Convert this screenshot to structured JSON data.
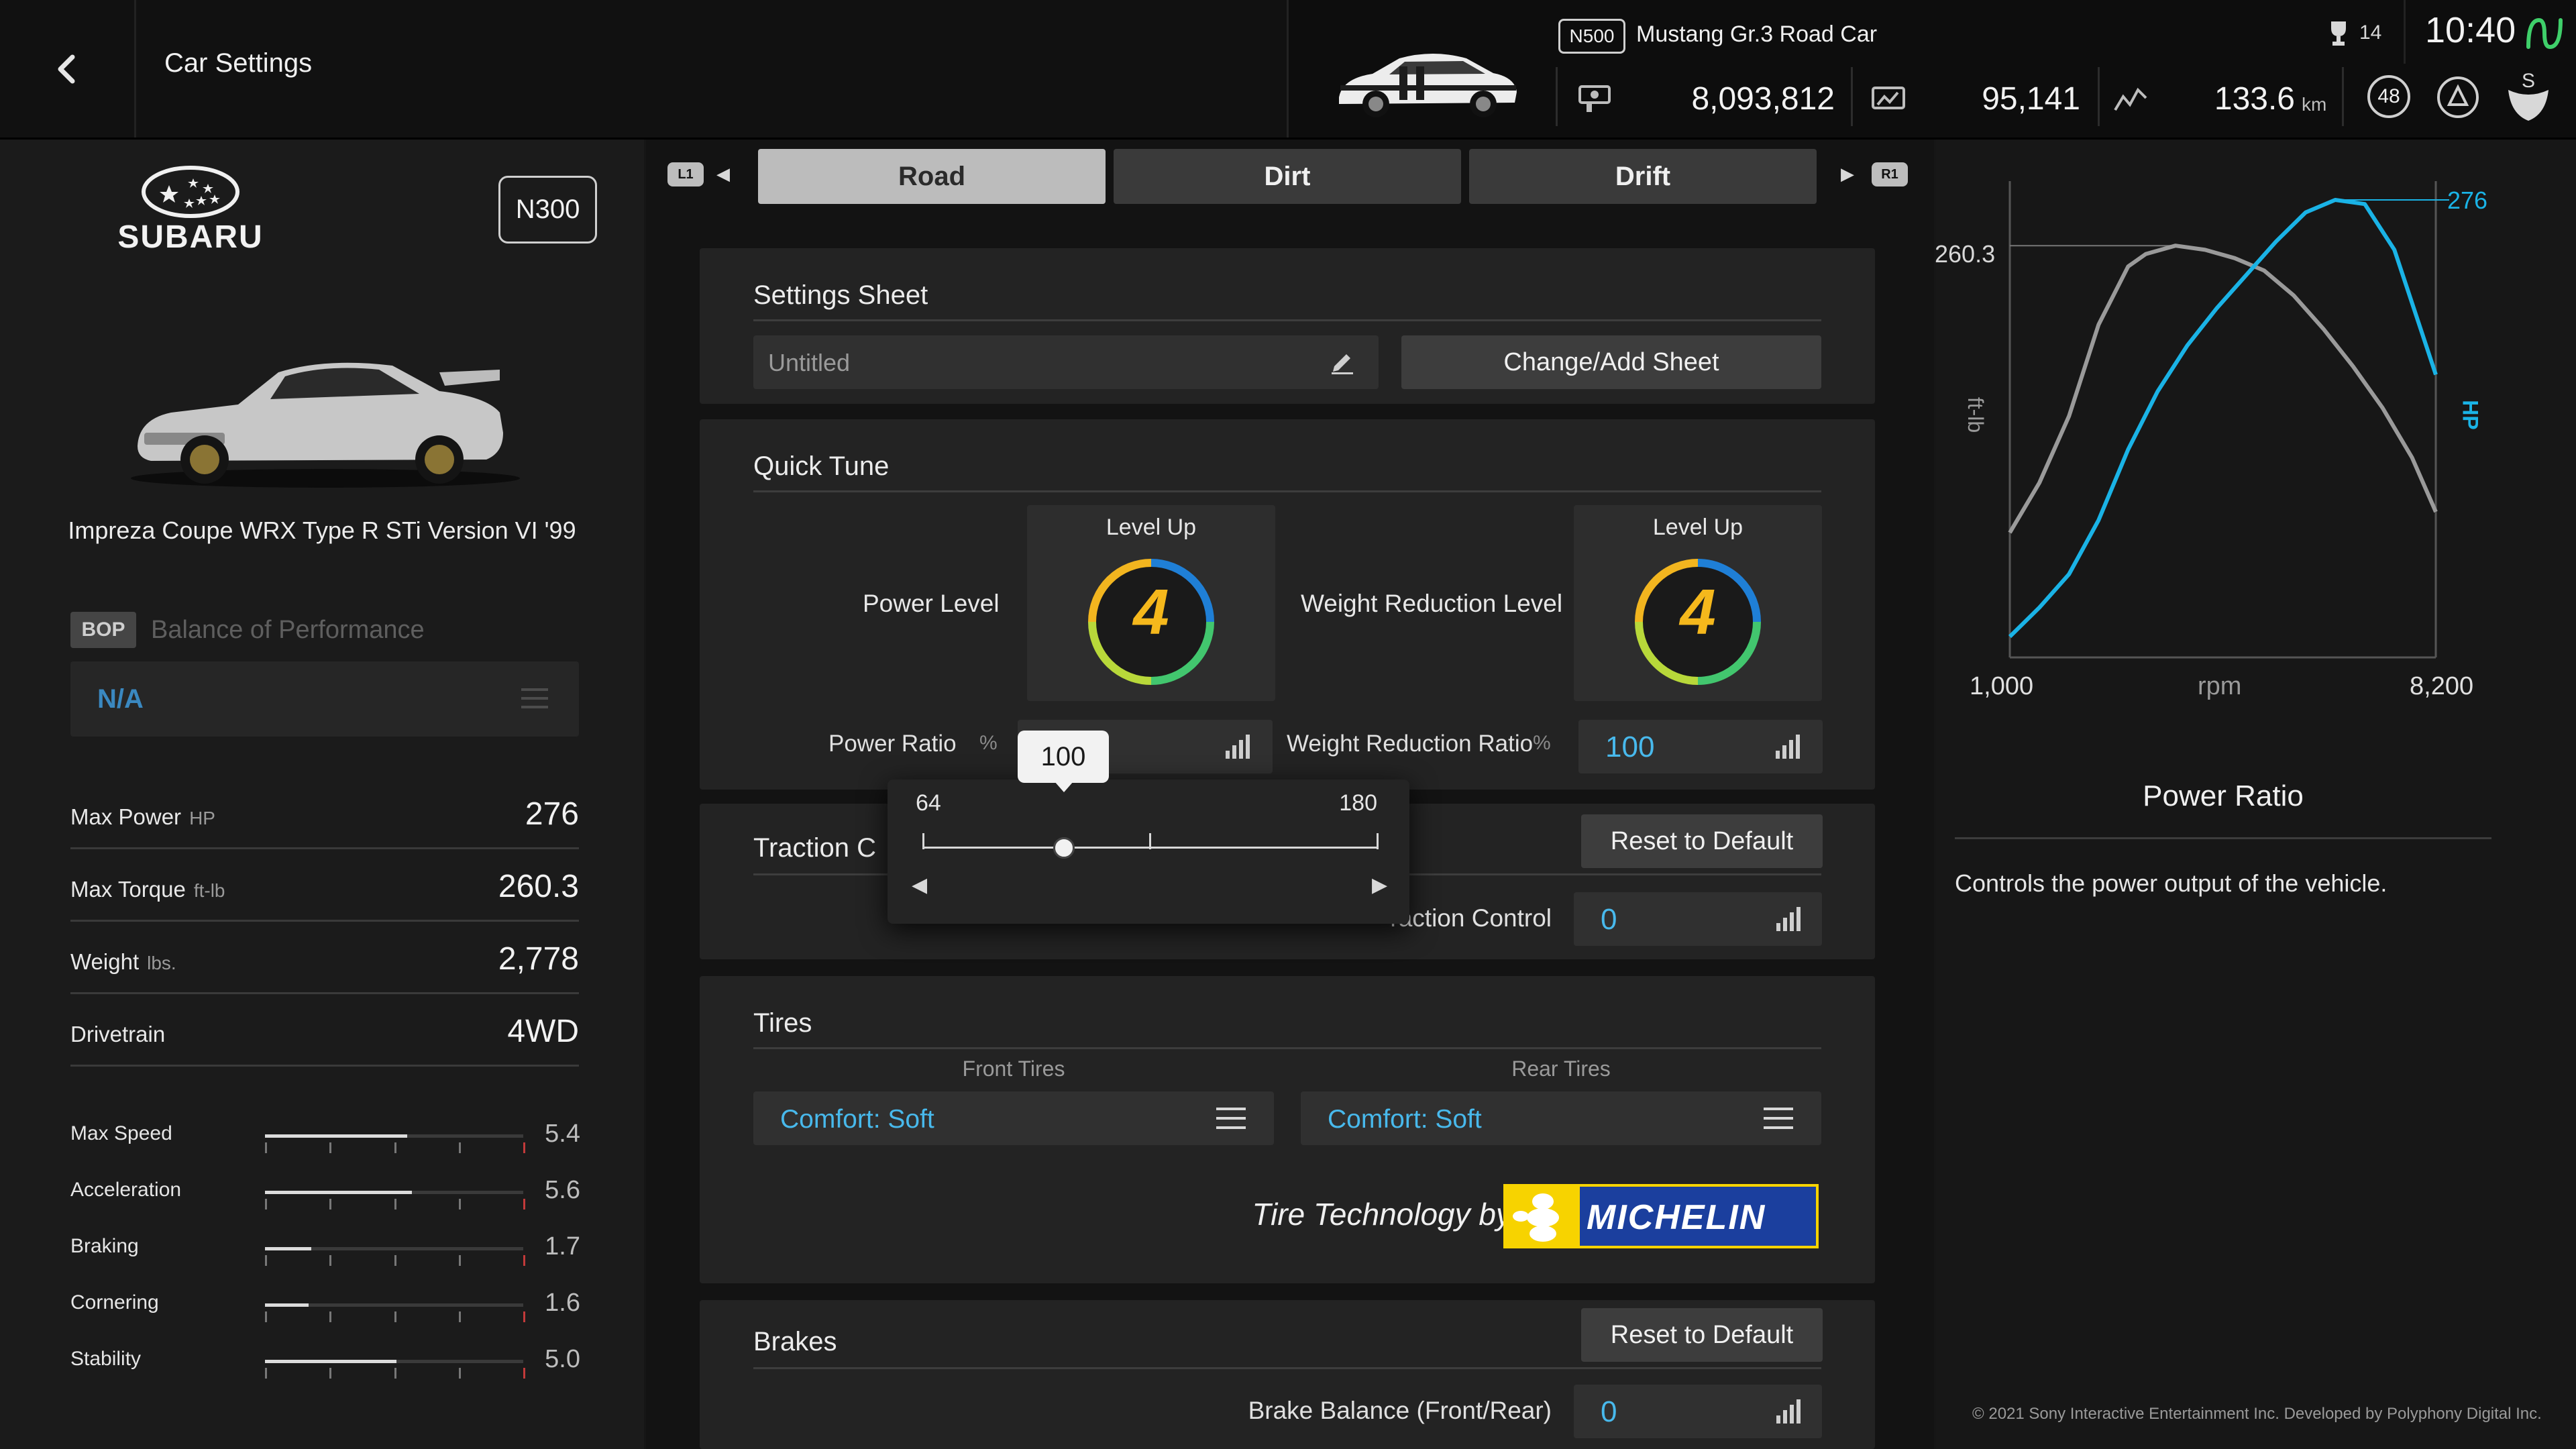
{
  "header": {
    "title": "Car Settings",
    "garage": {
      "class_badge": "N500",
      "car_name": "Mustang Gr.3 Road Car",
      "credits": "8,093,812",
      "mileage_points": "95,141",
      "distance": "133.6",
      "distance_unit": "km",
      "level": "48",
      "trophies": "14",
      "clock": "10:40"
    }
  },
  "car": {
    "brand": "SUBARU",
    "class_badge": "N300",
    "name": "Impreza Coupe WRX Type R STi Version VI '99"
  },
  "bop": {
    "badge": "BOP",
    "label": "Balance of Performance",
    "value": "N/A"
  },
  "stats": [
    {
      "label": "Max Power",
      "unit": "HP",
      "value": "276"
    },
    {
      "label": "Max Torque",
      "unit": "ft-lb",
      "value": "260.3"
    },
    {
      "label": "Weight",
      "unit": "lbs.",
      "value": "2,778"
    },
    {
      "label": "Drivetrain",
      "unit": "",
      "value": "4WD"
    }
  ],
  "performance": [
    {
      "label": "Max Speed",
      "value": "5.4",
      "fraction": 0.55
    },
    {
      "label": "Acceleration",
      "value": "5.6",
      "fraction": 0.57
    },
    {
      "label": "Braking",
      "value": "1.7",
      "fraction": 0.18
    },
    {
      "label": "Cornering",
      "value": "1.6",
      "fraction": 0.17
    },
    {
      "label": "Stability",
      "value": "5.0",
      "fraction": 0.51
    }
  ],
  "tabs": {
    "left_button": "L1",
    "right_button": "R1",
    "items": [
      "Road",
      "Dirt",
      "Drift"
    ],
    "active": "Road"
  },
  "settings_sheet": {
    "title": "Settings Sheet",
    "name": "Untitled",
    "change_button": "Change/Add Sheet"
  },
  "quick_tune": {
    "title": "Quick Tune",
    "power_level_label": "Power Level",
    "power_level_up": "Level Up",
    "power_level": "4",
    "weight_label": "Weight Reduction Level",
    "weight_level_up": "Level Up",
    "weight_level": "4",
    "power_ratio_label": "Power Ratio",
    "power_ratio_unit": "%",
    "power_ratio_value": "100",
    "weight_ratio_label": "Weight Reduction Ratio",
    "weight_ratio_unit": "%",
    "weight_ratio_value": "100"
  },
  "slider_popup": {
    "min": "64",
    "max": "180",
    "value": "100",
    "position_fraction": 0.31
  },
  "traction": {
    "title_visible": "Traction C",
    "reset_button": "Reset to Default",
    "row_label_visible": "raction Control",
    "value": "0"
  },
  "tires": {
    "title": "Tires",
    "front_label": "Front Tires",
    "rear_label": "Rear Tires",
    "front_value": "Comfort: Soft",
    "rear_value": "Comfort: Soft",
    "tech_label": "Tire Technology by",
    "brand_logo": "MICHELIN"
  },
  "brakes": {
    "title": "Brakes",
    "reset_button": "Reset to Default",
    "balance_label": "Brake Balance (Front/Rear)",
    "balance_value": "0"
  },
  "chart_data": {
    "type": "line",
    "x_min_label": "1,000",
    "x_max_label": "8,200",
    "xlabel": "rpm",
    "left_axis_label": "ft-lb",
    "right_axis_label": "HP",
    "torque_peak_label": "260.3",
    "power_peak_label": "276",
    "xlim": [
      1000,
      8200
    ],
    "series": [
      {
        "name": "ft-lb",
        "color": "#9a9a9a",
        "x": [
          1000,
          1500,
          2000,
          2500,
          3000,
          3300,
          3800,
          4300,
          4800,
          5300,
          5800,
          6300,
          6800,
          7300,
          7800,
          8200
        ],
        "y": [
          0.3,
          0.42,
          0.58,
          0.8,
          0.94,
          0.97,
          0.99,
          0.98,
          0.96,
          0.93,
          0.87,
          0.79,
          0.7,
          0.6,
          0.48,
          0.35
        ]
      },
      {
        "name": "HP",
        "color": "#1ab3e6",
        "x": [
          1000,
          1500,
          2000,
          2500,
          3000,
          3500,
          4000,
          4500,
          5000,
          5500,
          6000,
          6500,
          7000,
          7500,
          8200
        ],
        "y": [
          0.05,
          0.12,
          0.2,
          0.33,
          0.5,
          0.64,
          0.75,
          0.84,
          0.92,
          1.0,
          1.07,
          1.1,
          1.09,
          0.98,
          0.68
        ]
      }
    ]
  },
  "detail": {
    "title": "Power Ratio",
    "description": "Controls the power output of the vehicle."
  },
  "footer": {
    "copyright": "© 2021 Sony Interactive Entertainment Inc. Developed by Polyphony Digital Inc."
  }
}
